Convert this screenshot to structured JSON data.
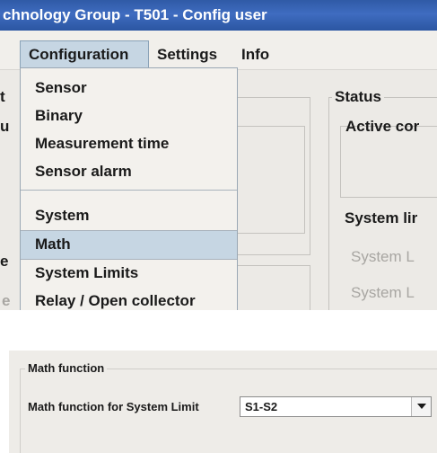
{
  "window": {
    "title": "chnology Group - T501 - Config user"
  },
  "menu_bar": {
    "configuration": "Configuration",
    "settings": "Settings",
    "info": "Info"
  },
  "configuration_menu": {
    "items": [
      "Sensor",
      "Binary",
      "Measurement time",
      "Sensor alarm",
      "System",
      "Math",
      "System Limits",
      "Relay / Open collector"
    ],
    "highlighted": "Math"
  },
  "background": {
    "left_fragments": [
      "t",
      "u",
      "e",
      "e"
    ],
    "status_label": "Status",
    "active_label": "Active cor",
    "system_limits_label": "System lir",
    "system_l_rows": [
      "System L",
      "System L"
    ]
  },
  "math_panel": {
    "group_title": "Math function",
    "field_label": "Math function for System Limit",
    "selected_value": "S1-S2",
    "dropdown_icon": "triangle-down-icon"
  }
}
